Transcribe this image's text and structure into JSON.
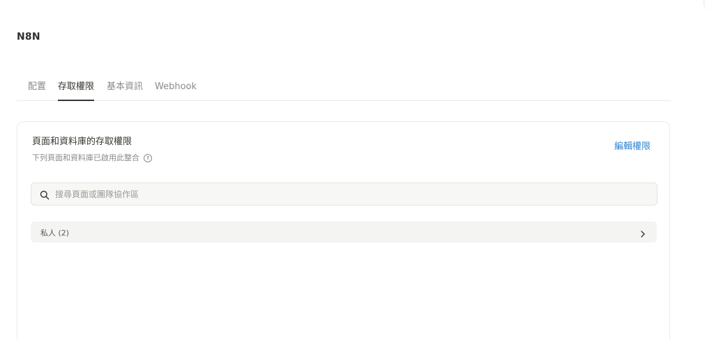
{
  "integration": {
    "title": "N8N"
  },
  "tabs": [
    {
      "label": "配置",
      "active": false
    },
    {
      "label": "存取權限",
      "active": true
    },
    {
      "label": "基本資訊",
      "active": false
    },
    {
      "label": "Webhook",
      "active": false
    }
  ],
  "access": {
    "title": "頁面和資料庫的存取權限",
    "subtitle": "下列頁面和資料庫已啟用此整合",
    "help_icon": "question-circle-icon",
    "edit_label": "編輯權限",
    "search": {
      "placeholder": "搜尋頁面或團隊協作區",
      "value": "",
      "icon": "search-icon"
    },
    "groups": [
      {
        "label": "私人 (2)",
        "icon": "chevron-right-icon"
      }
    ]
  },
  "colors": {
    "accent": "#2f86d3",
    "text": "#37352f",
    "muted": "#8b8a87"
  }
}
